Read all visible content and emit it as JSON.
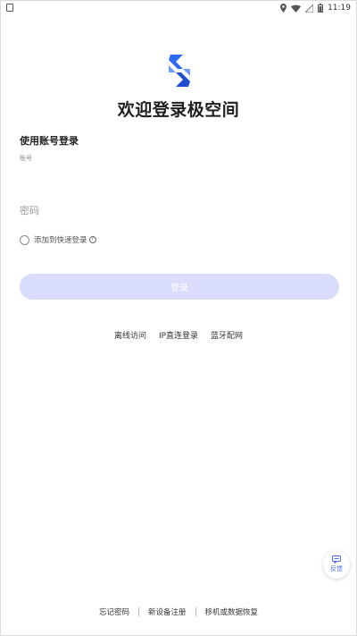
{
  "status_bar": {
    "time": "11:19"
  },
  "header": {
    "title": "欢迎登录极空间"
  },
  "login": {
    "section_title": "使用账号登录",
    "account_label": "账号",
    "account_value": "",
    "password_placeholder": "密码",
    "quick_login_label": "添加到快速登录",
    "login_button": "登录"
  },
  "alt_links": [
    "离线访问",
    "IP直连登录",
    "蓝牙配网"
  ],
  "feedback": {
    "label": "反馈"
  },
  "footer_links": [
    "忘记密码",
    "新设备注册",
    "移机或数据恢复"
  ],
  "colors": {
    "brand_blue": "#2f6bf0",
    "button_disabled": "#d9dcfb",
    "feedback_accent": "#4a6cf0"
  },
  "icons": {
    "logo": "jikongjian-logo",
    "help": "question-circle-icon",
    "feedback": "feedback-icon"
  }
}
